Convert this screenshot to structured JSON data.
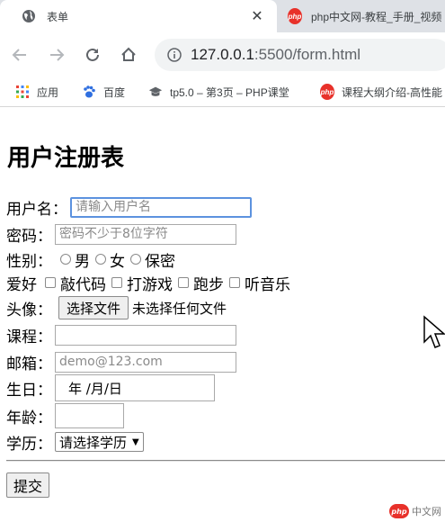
{
  "tabs": [
    {
      "title": "表单",
      "active": true,
      "icon": "globe-icon"
    },
    {
      "title": "php中文网-教程_手册_视频",
      "active": false,
      "icon": "php-icon"
    }
  ],
  "toolbar": {
    "url_host": "127.0.0.1",
    "url_rest": ":5500/form.html"
  },
  "bookmarks": [
    {
      "label": "应用",
      "icon": "apps-grid-icon"
    },
    {
      "label": "百度",
      "icon": "baidu-paw-icon"
    },
    {
      "label": "tp5.0 – 第3页 – PHP课堂",
      "icon": "graduation-cap-icon"
    },
    {
      "label": "课程大纲介绍-高性能",
      "icon": "php-icon"
    }
  ],
  "form": {
    "heading": "用户注册表",
    "username": {
      "label": "用户名：",
      "placeholder": "请输入用户名"
    },
    "password": {
      "label": "密码：",
      "placeholder": "密码不少于8位字符"
    },
    "gender": {
      "label": "性别：",
      "options": [
        "男",
        "女",
        "保密"
      ]
    },
    "hobby": {
      "label": "爱好",
      "options": [
        "敲代码",
        "打游戏",
        "跑步",
        "听音乐"
      ]
    },
    "avatar": {
      "label": "头像：",
      "button": "选择文件",
      "status": "未选择任何文件"
    },
    "course": {
      "label": "课程：",
      "value": ""
    },
    "email": {
      "label": "邮箱：",
      "placeholder": "demo@123.com"
    },
    "birthday": {
      "label": "生日：",
      "value": "年 /月/日"
    },
    "age": {
      "label": "年龄：",
      "value": ""
    },
    "education": {
      "label": "学历：",
      "selected": "请选择学历"
    },
    "submit": "提交"
  },
  "watermark": "中文网"
}
